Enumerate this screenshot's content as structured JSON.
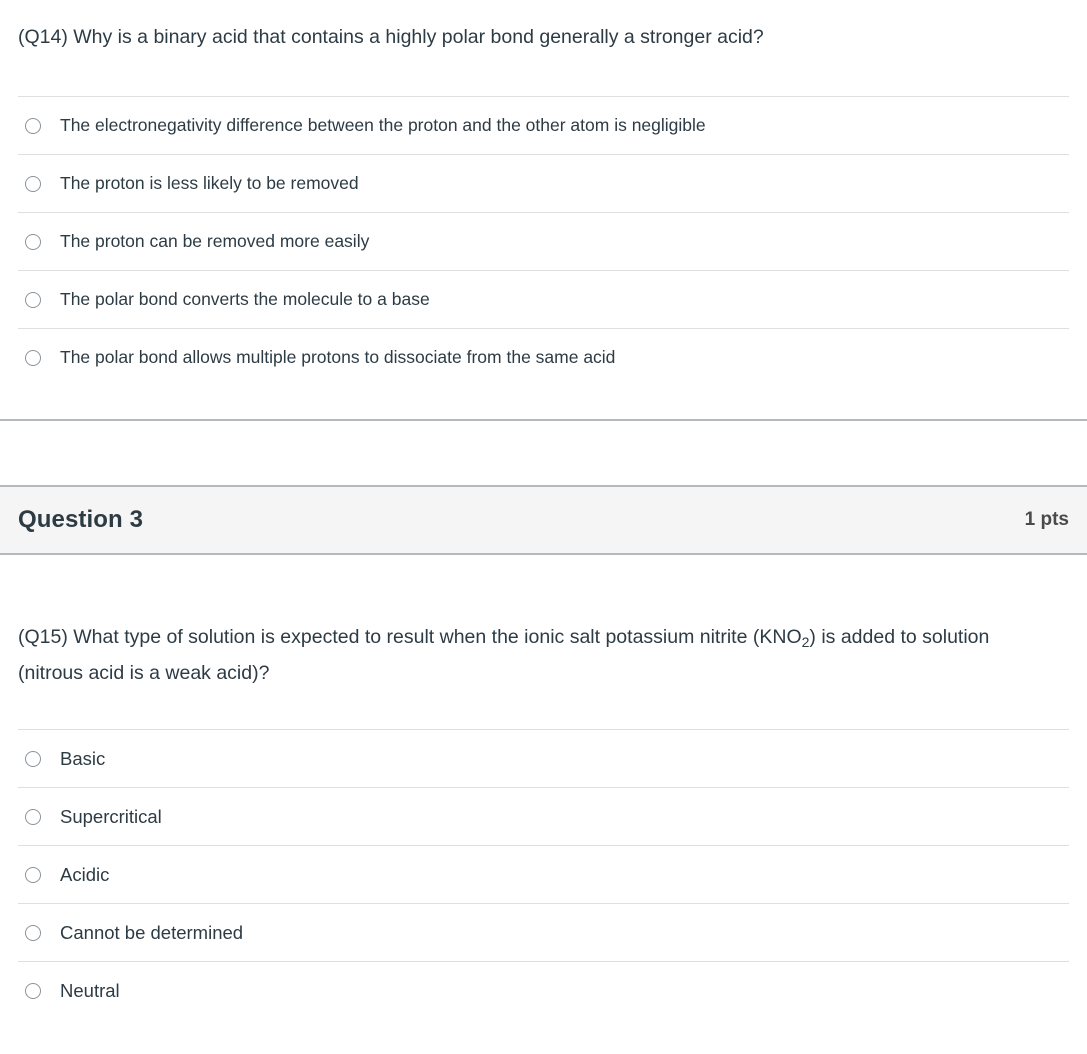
{
  "question_two": {
    "stem_prefix": "(Q14) Why is a binary acid that contains a highly polar bond generally a stronger acid?",
    "options": [
      {
        "label": "The electronegativity difference between the proton and the other atom is negligible"
      },
      {
        "label": "The proton is less likely to be removed"
      },
      {
        "label": "The proton can be removed more easily"
      },
      {
        "label": "The polar bond converts the molecule to a base"
      },
      {
        "label": "The polar bond allows multiple protons to dissociate from the same acid"
      }
    ]
  },
  "question_three": {
    "header": {
      "title": "Question 3",
      "points": "1 pts"
    },
    "stem": {
      "part1": "(Q15) What type of solution is expected to result when the ionic salt potassium nitrite (KNO",
      "subscript": "2",
      "part2": ") is added to solution (nitrous acid is a weak acid)?"
    },
    "options": [
      {
        "label": "Basic"
      },
      {
        "label": "Supercritical"
      },
      {
        "label": "Acidic"
      },
      {
        "label": "Cannot be determined"
      },
      {
        "label": "Neutral"
      }
    ]
  },
  "colors": {
    "text": "#2d3b45",
    "header_background": "#f5f5f5",
    "header_border": "#b3b9bd",
    "row_divider": "#dfdfdf",
    "radio_border": "#8b949b",
    "page_background": "#ffffff"
  },
  "icons": {
    "radio_unselected": "radio-unselected-icon"
  }
}
